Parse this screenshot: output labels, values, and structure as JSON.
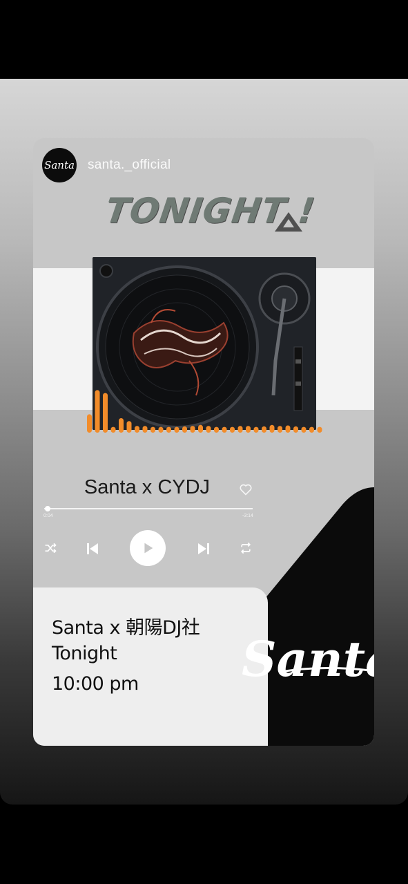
{
  "profile": {
    "username": "santa._official",
    "avatar_text": "Santa"
  },
  "headline": {
    "text": "TONIGHT !"
  },
  "player": {
    "track_title": "Santa x CYDJ",
    "time_elapsed": "0:04",
    "time_remaining": "-3:14",
    "progress": 0.01
  },
  "event": {
    "line1": "Santa x 朝陽DJ社",
    "line2": "Tonight",
    "line3": "10:00 pm"
  },
  "logo": {
    "text": "Santa"
  },
  "colors": {
    "accent": "#f28c2a",
    "card": "#c7c7c7",
    "dark": "#0b0b0b"
  },
  "equalizer": {
    "levels": [
      0.38,
      0.88,
      0.82,
      0.12,
      0.3,
      0.24,
      0.14,
      0.14,
      0.12,
      0.12,
      0.12,
      0.12,
      0.13,
      0.14,
      0.16,
      0.14,
      0.12,
      0.12,
      0.12,
      0.14,
      0.14,
      0.12,
      0.13,
      0.16,
      0.14,
      0.15,
      0.13,
      0.12,
      0.12,
      0.12
    ]
  }
}
